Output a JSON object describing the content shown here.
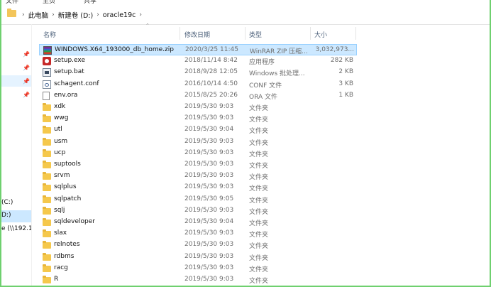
{
  "ribbon_partial": [
    "文件",
    "主页",
    "共享"
  ],
  "breadcrumb": [
    "此电脑",
    "新建卷 (D:)",
    "oracle19c"
  ],
  "columns": {
    "name": "名称",
    "date": "修改日期",
    "type": "类型",
    "size": "大小"
  },
  "nav": {
    "items": [
      {
        "label": "(C:)"
      },
      {
        "label": "D:)"
      },
      {
        "label": "e (\\\\192.1"
      }
    ]
  },
  "files": [
    {
      "name": "WINDOWS.X64_193000_db_home.zip",
      "date": "2020/3/25 11:45",
      "type": "WinRAR ZIP 压缩...",
      "size": "3,032,973...",
      "icon": "winrar-zip-icon",
      "selected": true
    },
    {
      "name": "setup.exe",
      "date": "2018/11/14 8:42",
      "type": "应用程序",
      "size": "282 KB",
      "icon": "exe-icon"
    },
    {
      "name": "setup.bat",
      "date": "2018/9/28 12:05",
      "type": "Windows 批处理...",
      "size": "2 KB",
      "icon": "bat-icon"
    },
    {
      "name": "schagent.conf",
      "date": "2016/10/14 4:50",
      "type": "CONF 文件",
      "size": "3 KB",
      "icon": "conf-icon"
    },
    {
      "name": "env.ora",
      "date": "2015/8/25 20:26",
      "type": "ORA 文件",
      "size": "1 KB",
      "icon": "file-icon"
    },
    {
      "name": "xdk",
      "date": "2019/5/30 9:03",
      "type": "文件夹",
      "size": "",
      "icon": "folder-icon"
    },
    {
      "name": "wwg",
      "date": "2019/5/30 9:03",
      "type": "文件夹",
      "size": "",
      "icon": "folder-icon"
    },
    {
      "name": "utl",
      "date": "2019/5/30 9:04",
      "type": "文件夹",
      "size": "",
      "icon": "folder-icon"
    },
    {
      "name": "usm",
      "date": "2019/5/30 9:03",
      "type": "文件夹",
      "size": "",
      "icon": "folder-icon"
    },
    {
      "name": "ucp",
      "date": "2019/5/30 9:03",
      "type": "文件夹",
      "size": "",
      "icon": "folder-icon"
    },
    {
      "name": "suptools",
      "date": "2019/5/30 9:03",
      "type": "文件夹",
      "size": "",
      "icon": "folder-icon"
    },
    {
      "name": "srvm",
      "date": "2019/5/30 9:03",
      "type": "文件夹",
      "size": "",
      "icon": "folder-icon"
    },
    {
      "name": "sqlplus",
      "date": "2019/5/30 9:03",
      "type": "文件夹",
      "size": "",
      "icon": "folder-icon"
    },
    {
      "name": "sqlpatch",
      "date": "2019/5/30 9:05",
      "type": "文件夹",
      "size": "",
      "icon": "folder-icon"
    },
    {
      "name": "sqlj",
      "date": "2019/5/30 9:03",
      "type": "文件夹",
      "size": "",
      "icon": "folder-icon"
    },
    {
      "name": "sqldeveloper",
      "date": "2019/5/30 9:04",
      "type": "文件夹",
      "size": "",
      "icon": "folder-icon"
    },
    {
      "name": "slax",
      "date": "2019/5/30 9:03",
      "type": "文件夹",
      "size": "",
      "icon": "folder-icon"
    },
    {
      "name": "relnotes",
      "date": "2019/5/30 9:03",
      "type": "文件夹",
      "size": "",
      "icon": "folder-icon"
    },
    {
      "name": "rdbms",
      "date": "2019/5/30 9:03",
      "type": "文件夹",
      "size": "",
      "icon": "folder-icon"
    },
    {
      "name": "racg",
      "date": "2019/5/30 9:03",
      "type": "文件夹",
      "size": "",
      "icon": "folder-icon"
    },
    {
      "name": "R",
      "date": "2019/5/30 9:03",
      "type": "文件夹",
      "size": "",
      "icon": "folder-icon"
    }
  ],
  "colors": {
    "selection": "#cce8ff",
    "selection_border": "#99d1ff",
    "folder": "#f5c84c",
    "frame": "#6fd06f"
  }
}
